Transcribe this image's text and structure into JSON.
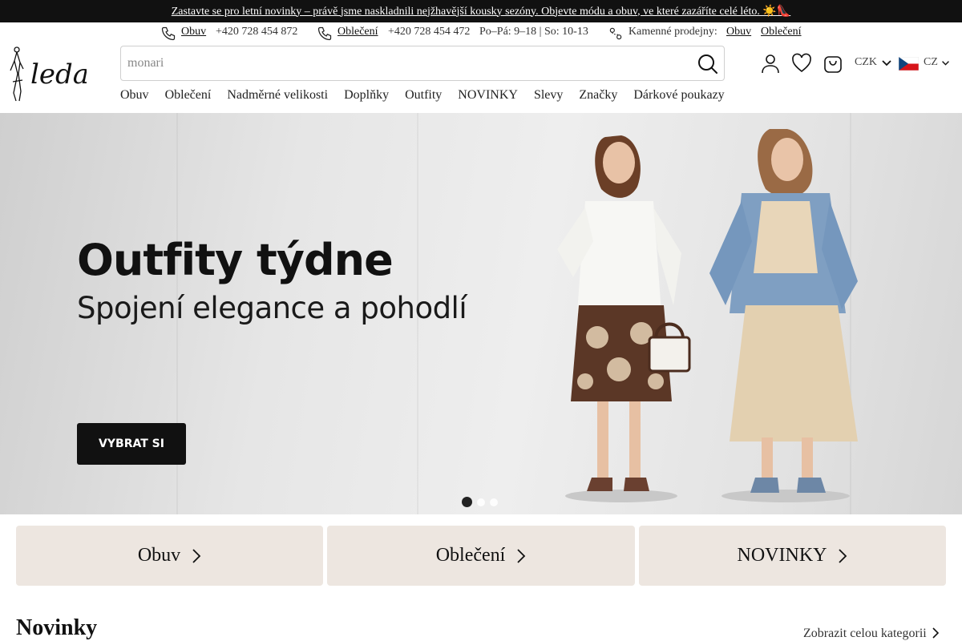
{
  "announcement": "Zastavte se pro letní novinky – právě jsme naskladnili nejžhavější kousky sezóny. Objevte módu a obuv, ve které zazáříte celé léto. ☀️👠",
  "contact": {
    "shoes_link": "Obuv",
    "shoes_phone": "+420 728 454 872",
    "clothes_link": "Oblečení",
    "clothes_phone": "+420 728 454 472",
    "hours": "Po–Pá: 9–18 | So: 10-13",
    "stores_label": "Kamenné prodejny:",
    "stores_shoes": "Obuv",
    "stores_clothes": "Oblečení"
  },
  "logo_text": "leda",
  "search": {
    "value": "",
    "placeholder": "monari"
  },
  "header": {
    "currency": "CZK",
    "language": "CZ"
  },
  "nav": [
    "Obuv",
    "Oblečení",
    "Nadměrné velikosti",
    "Doplňky",
    "Outfity",
    "NOVINKY",
    "Slevy",
    "Značky",
    "Dárkové poukazy"
  ],
  "hero": {
    "title": "Outfity týdne",
    "subtitle": "Spojení elegance a pohodlí",
    "button": "VYBRAT SI",
    "slide_count": 3,
    "active_slide": 1
  },
  "tiles": [
    "Obuv",
    "Oblečení",
    "NOVINKY"
  ],
  "section": {
    "title": "Novinky",
    "see_all": "Zobrazit celou kategorii"
  },
  "colors": {
    "dark": "#111111",
    "tile_bg": "#ede6e0",
    "flag_red": "#d7141a",
    "flag_blue": "#11457e"
  },
  "icons": [
    "phone-icon",
    "store-location-icon",
    "search-icon",
    "user-icon",
    "heart-icon",
    "bag-icon",
    "chevron-down-icon",
    "chevron-right-icon",
    "cz-flag-icon"
  ]
}
